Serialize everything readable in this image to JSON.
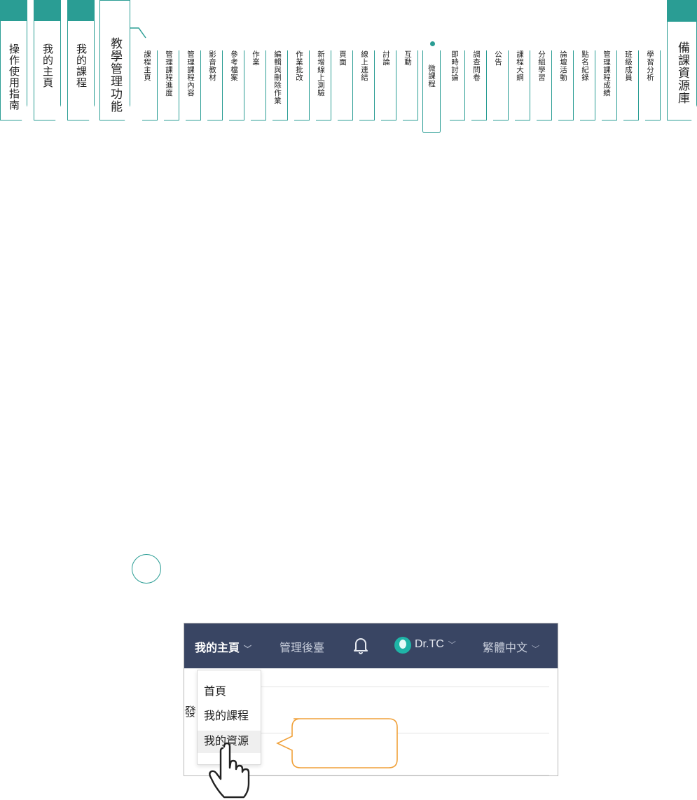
{
  "manual_tabs": [
    {
      "label": "操作使用指南"
    },
    {
      "label": "我的主頁"
    },
    {
      "label": "我的課程"
    },
    {
      "label": "教學管理功能"
    }
  ],
  "right_tab": {
    "label": "備課資源庫"
  },
  "sub_tabs": [
    "課程主頁",
    "管理課程進度",
    "管理課程內容",
    "影音教材",
    "參考檔案",
    "作業",
    "編輯與刪除作業",
    "作業批改",
    "新增線上測驗",
    "頁面",
    "線上連結",
    "討論",
    "互動",
    "微課程",
    "即時討論",
    "調查問卷",
    "公告",
    "課程大綱",
    "分組學習",
    "論壇活動",
    "點名紀錄",
    "管理課程成績",
    "班級成員",
    "學習分析"
  ],
  "active_sub_tab": "微課程",
  "colors": {
    "accent": "#2a9d94",
    "nav_bg": "#394563",
    "callout": "#f0a13a"
  },
  "screenshot": {
    "nav": {
      "home": "我的主頁",
      "admin": "管理後臺",
      "bell_icon": "bell-icon",
      "user": "Dr.TC",
      "language": "繁體中文"
    },
    "dropdown": [
      "首頁",
      "我的課程",
      "我的資源"
    ],
    "dropdown_highlight": "我的資源",
    "partial_text": "發"
  }
}
